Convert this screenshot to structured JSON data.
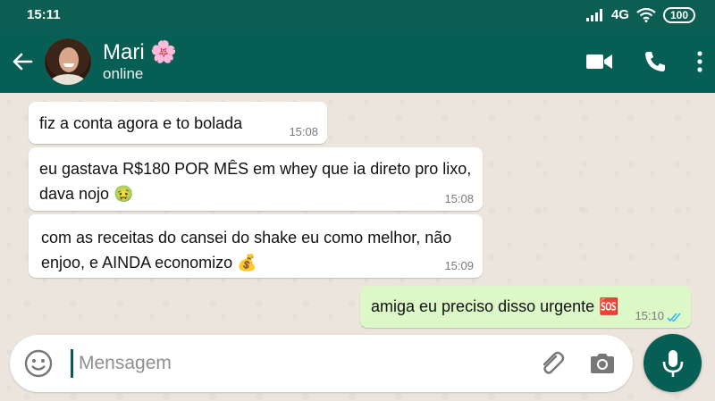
{
  "status_bar": {
    "time": "15:11",
    "network": "4G",
    "battery": "100"
  },
  "header": {
    "back_icon": "arrow-left-icon",
    "contact_name": "Mari 🌸",
    "contact_status": "online",
    "icons": [
      "video-call-icon",
      "phone-icon",
      "more-vert-icon"
    ]
  },
  "messages": [
    {
      "direction": "incoming",
      "text": "fiz a conta agora e to bolada",
      "time": "15:08"
    },
    {
      "direction": "incoming",
      "text": "eu gastava R$180 POR MÊS em whey que ia direto pro lixo, dava nojo 🤢",
      "time": "15:08"
    },
    {
      "direction": "incoming",
      "text": "com as receitas do cansei do shake eu como melhor, não enjoo, e AINDA economizo 💰",
      "time": "15:09"
    },
    {
      "direction": "outgoing",
      "text": "amiga eu preciso disso urgente 🆘",
      "time": "15:10",
      "read": true
    }
  ],
  "input": {
    "placeholder": "Mensagem",
    "emoji_icon": "smiley-icon",
    "attach_icon": "paperclip-icon",
    "camera_icon": "camera-icon",
    "mic_icon": "microphone-icon"
  },
  "colors": {
    "header": "#075e54",
    "status_bar": "#0b5e51",
    "outgoing_bubble": "#dcf8c6",
    "incoming_bubble": "#ffffff",
    "read_ticks": "#34b7f1"
  }
}
